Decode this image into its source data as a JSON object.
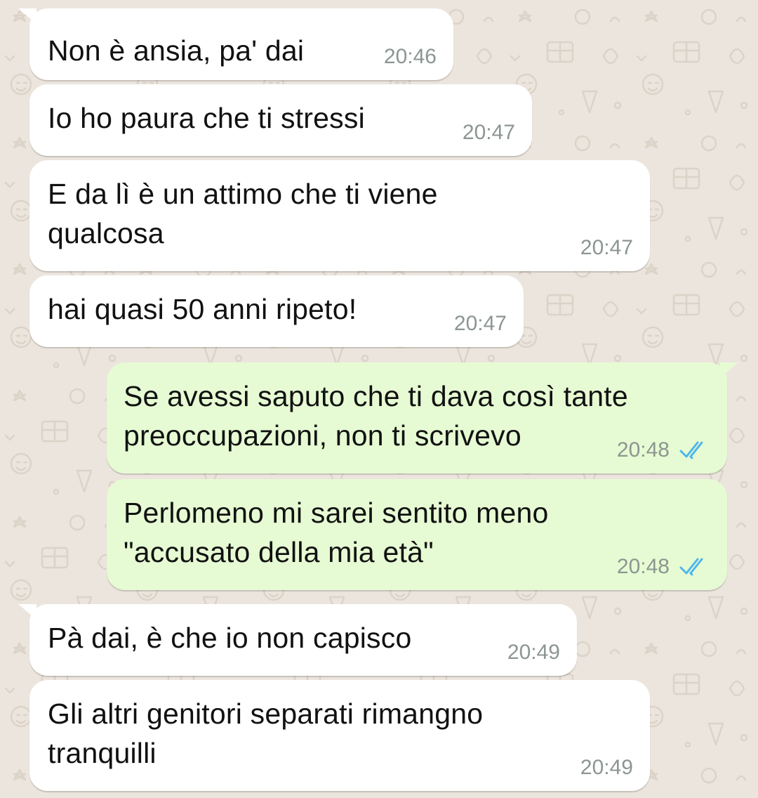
{
  "colors": {
    "background": "#ece5dd",
    "incoming_bubble": "#ffffff",
    "outgoing_bubble": "#e6fbd3",
    "timestamp": "#8c9691",
    "read_ticks": "#4fb6ec"
  },
  "messages": [
    {
      "direction": "incoming",
      "lines": [
        "Non è ansia, pa' dai"
      ],
      "time": "20:46"
    },
    {
      "direction": "incoming",
      "lines": [
        "Io ho paura che ti stressi"
      ],
      "time": "20:47"
    },
    {
      "direction": "incoming",
      "lines": [
        "E da lì è un attimo che ti viene",
        "qualcosa"
      ],
      "time": "20:47"
    },
    {
      "direction": "incoming",
      "lines": [
        "hai quasi 50 anni ripeto!"
      ],
      "time": "20:47"
    },
    {
      "direction": "outgoing",
      "lines": [
        "Se avessi saputo che ti dava così tante",
        "preoccupazioni, non ti scrivevo"
      ],
      "time": "20:48",
      "status_icon": "double-check-read-icon"
    },
    {
      "direction": "outgoing",
      "lines": [
        "Perlomeno mi sarei sentito meno",
        "\"accusato della mia età\""
      ],
      "time": "20:48",
      "status_icon": "double-check-read-icon"
    },
    {
      "direction": "incoming",
      "lines": [
        "Pà dai, è che io non capisco"
      ],
      "time": "20:49"
    },
    {
      "direction": "incoming",
      "lines": [
        "Gli altri genitori separati rimangno",
        "tranquilli"
      ],
      "time": "20:49"
    }
  ]
}
